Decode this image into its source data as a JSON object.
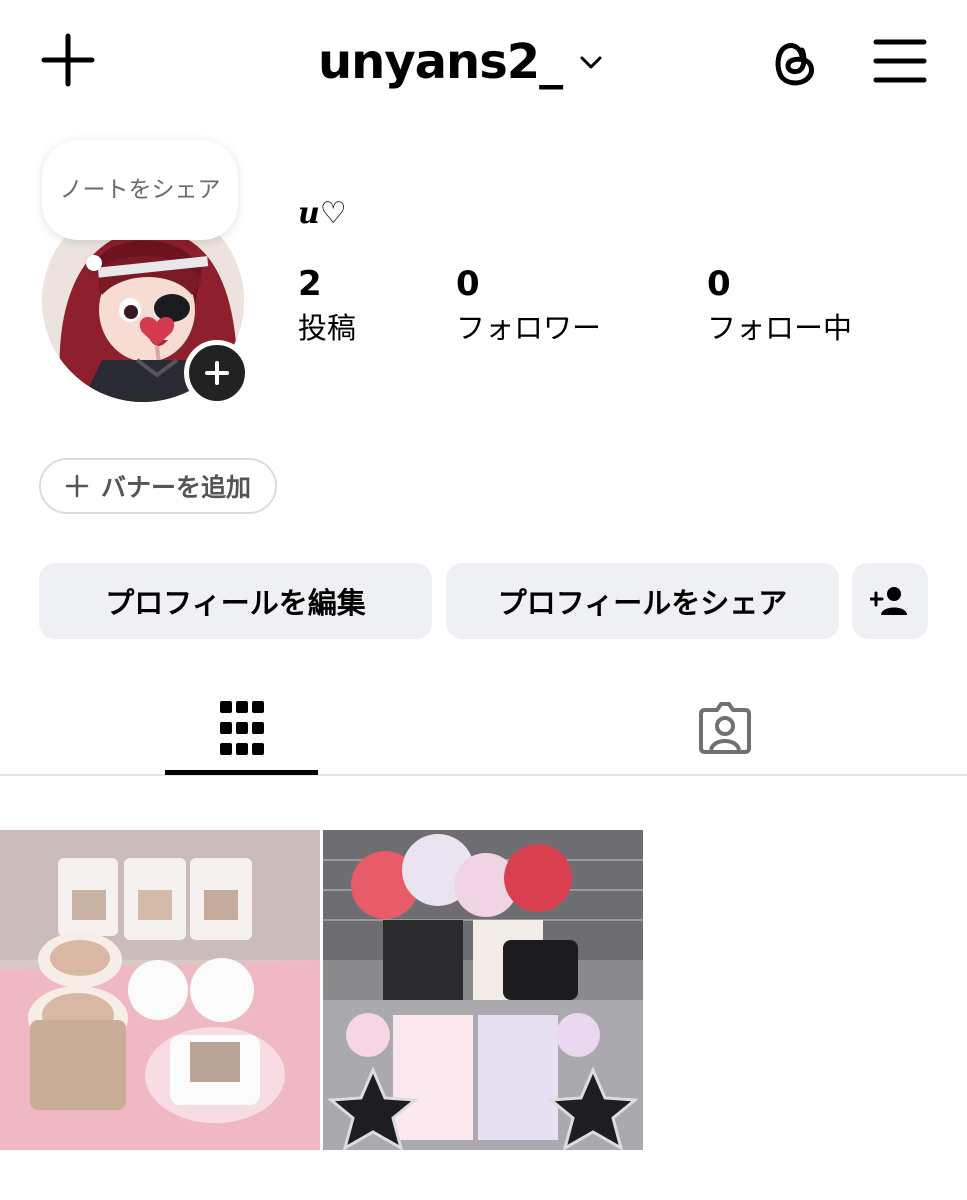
{
  "header": {
    "username": "unyans2_",
    "icons": {
      "new_post": "plus-icon",
      "account_switch": "chevron-down-icon",
      "threads": "threads-icon",
      "menu": "hamburger-menu-icon"
    }
  },
  "profile": {
    "note_text": "ノートをシェア",
    "display_name": "u♡",
    "stats": [
      {
        "value": "2",
        "label": "投稿"
      },
      {
        "value": "0",
        "label": "フォロワー"
      },
      {
        "value": "0",
        "label": "フォロー中"
      }
    ]
  },
  "banner_button": {
    "icon": "plus-icon",
    "label": "バナーを追加"
  },
  "actions": {
    "edit_profile": "プロフィールを編集",
    "share_profile": "プロフィールをシェア",
    "discover_people_icon": "add-person-icon"
  },
  "tabs": [
    {
      "name": "posts",
      "icon": "grid-icon",
      "selected": true
    },
    {
      "name": "tagged",
      "icon": "tagged-person-icon",
      "selected": false
    }
  ],
  "posts": [
    {
      "description": "cafe latte art photo"
    },
    {
      "description": "merch collection photo"
    }
  ],
  "colors": {
    "button_bg": "#eff0f3",
    "divider": "#e6e6e6",
    "text": "#000000",
    "secondary_text": "#555555"
  }
}
